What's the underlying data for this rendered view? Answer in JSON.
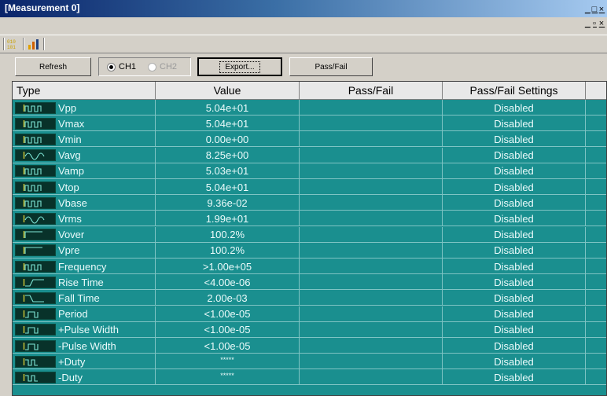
{
  "window": {
    "title": "[Measurement 0]",
    "controls": [
      "_",
      "□",
      "×"
    ],
    "controls2": [
      "_",
      "▫",
      "×"
    ]
  },
  "toolbar": {
    "icons": [
      "binary-icon",
      "chart-icon"
    ]
  },
  "buttons": {
    "refresh": "Refresh",
    "ch1": "CH1",
    "ch2": "CH2",
    "export": "Export...",
    "passfail": "Pass/Fail"
  },
  "table": {
    "headers": [
      "Type",
      "Value",
      "Pass/Fail",
      "Pass/Fail Settings"
    ],
    "rows": [
      {
        "type": "Vpp",
        "value": "5.04e+01",
        "passfail": "",
        "settings": "Disabled",
        "icon": "vpp-wave-icon"
      },
      {
        "type": "Vmax",
        "value": "5.04e+01",
        "passfail": "",
        "settings": "Disabled",
        "icon": "vmax-wave-icon"
      },
      {
        "type": "Vmin",
        "value": "0.00e+00",
        "passfail": "",
        "settings": "Disabled",
        "icon": "vmin-wave-icon"
      },
      {
        "type": "Vavg",
        "value": "8.25e+00",
        "passfail": "",
        "settings": "Disabled",
        "icon": "vavg-wave-icon"
      },
      {
        "type": "Vamp",
        "value": "5.03e+01",
        "passfail": "",
        "settings": "Disabled",
        "icon": "vamp-wave-icon"
      },
      {
        "type": "Vtop",
        "value": "5.04e+01",
        "passfail": "",
        "settings": "Disabled",
        "icon": "vtop-wave-icon"
      },
      {
        "type": "Vbase",
        "value": "9.36e-02",
        "passfail": "",
        "settings": "Disabled",
        "icon": "vbase-wave-icon"
      },
      {
        "type": "Vrms",
        "value": "1.99e+01",
        "passfail": "",
        "settings": "Disabled",
        "icon": "vrms-wave-icon"
      },
      {
        "type": "Vover",
        "value": "100.2%",
        "passfail": "",
        "settings": "Disabled",
        "icon": "vover-wave-icon"
      },
      {
        "type": "Vpre",
        "value": "100.2%",
        "passfail": "",
        "settings": "Disabled",
        "icon": "vpre-wave-icon"
      },
      {
        "type": "Frequency",
        "value": ">1.00e+05",
        "passfail": "",
        "settings": "Disabled",
        "icon": "frequency-wave-icon"
      },
      {
        "type": "Rise Time",
        "value": "<4.00e-06",
        "passfail": "",
        "settings": "Disabled",
        "icon": "rise-time-icon"
      },
      {
        "type": "Fall Time",
        "value": "2.00e-03",
        "passfail": "",
        "settings": "Disabled",
        "icon": "fall-time-icon"
      },
      {
        "type": "Period",
        "value": "<1.00e-05",
        "passfail": "",
        "settings": "Disabled",
        "icon": "period-wave-icon"
      },
      {
        "type": "+Pulse Width",
        "value": "<1.00e-05",
        "passfail": "",
        "settings": "Disabled",
        "icon": "pos-pulse-width-icon"
      },
      {
        "type": "-Pulse Width",
        "value": "<1.00e-05",
        "passfail": "",
        "settings": "Disabled",
        "icon": "neg-pulse-width-icon"
      },
      {
        "type": "+Duty",
        "value": "*****",
        "passfail": "",
        "settings": "Disabled",
        "icon": "pos-duty-icon"
      },
      {
        "type": "-Duty",
        "value": "*****",
        "passfail": "",
        "settings": "Disabled",
        "icon": "neg-duty-icon"
      }
    ]
  },
  "colors": {
    "grid_bg": "#1a8f8f",
    "header_bg": "#e8e8e8",
    "icon_wave": "#7fe8d8",
    "icon_marker": "#f2e23a"
  }
}
